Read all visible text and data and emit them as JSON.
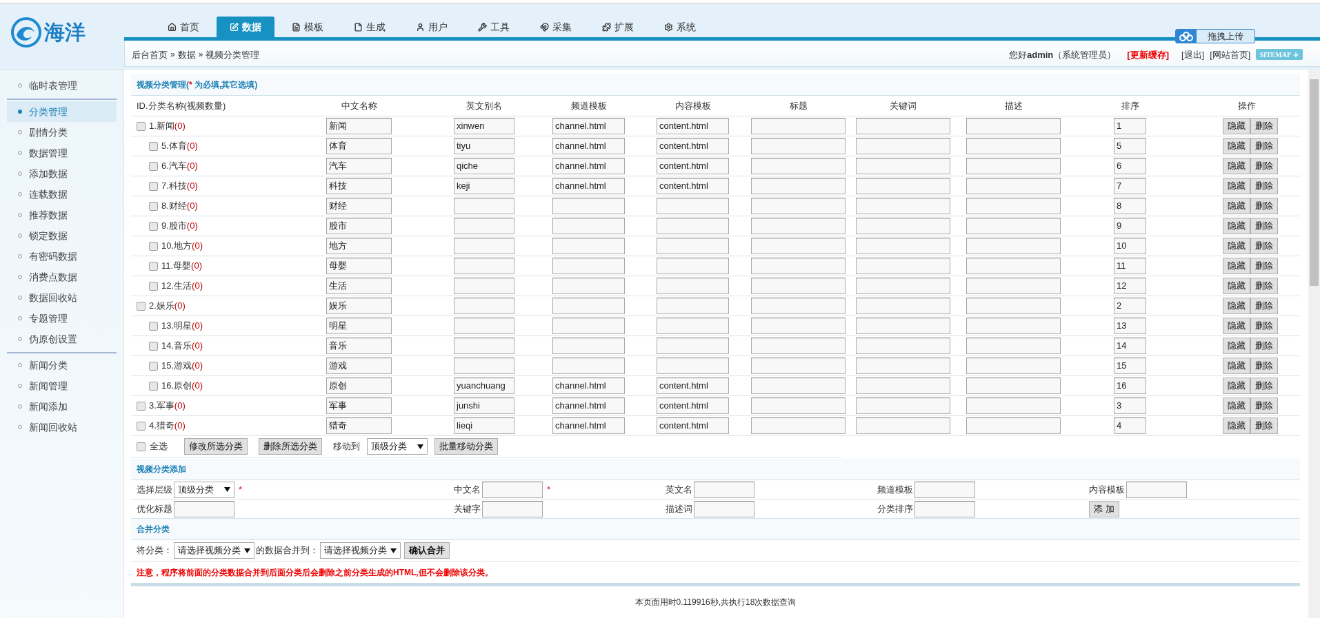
{
  "logo": {
    "text": "海洋"
  },
  "nav": {
    "tabs": [
      {
        "label": "首页",
        "selected": false
      },
      {
        "label": "数据",
        "selected": true
      },
      {
        "label": "模板",
        "selected": false
      },
      {
        "label": "生成",
        "selected": false
      },
      {
        "label": "用户",
        "selected": false
      },
      {
        "label": "工具",
        "selected": false
      },
      {
        "label": "采集",
        "selected": false
      },
      {
        "label": "扩展",
        "selected": false
      },
      {
        "label": "系统",
        "selected": false
      }
    ]
  },
  "upload_button": "拖拽上传",
  "breadcrumb": {
    "items": [
      "后台首页",
      "数据",
      "视频分类管理"
    ],
    "separator": "»"
  },
  "user_bar": {
    "greeting": "您好",
    "user": "admin",
    "role": "（系统管理员）",
    "refresh": "[更新缓存]",
    "logout": "[退出]",
    "site_home": "[网站首页]",
    "sitemap": "SITEMAP"
  },
  "sidebar": {
    "groups": [
      [
        {
          "label": "临时表管理",
          "selected": false
        }
      ],
      [
        {
          "label": "分类管理",
          "selected": true
        },
        {
          "label": "剧情分类",
          "selected": false
        },
        {
          "label": "数据管理",
          "selected": false
        },
        {
          "label": "添加数据",
          "selected": false
        },
        {
          "label": "连载数据",
          "selected": false
        },
        {
          "label": "推荐数据",
          "selected": false
        },
        {
          "label": "锁定数据",
          "selected": false
        },
        {
          "label": "有密码数据",
          "selected": false
        },
        {
          "label": "消费点数据",
          "selected": false
        },
        {
          "label": "数据回收站",
          "selected": false
        },
        {
          "label": "专题管理",
          "selected": false
        },
        {
          "label": "伪原创设置",
          "selected": false
        }
      ],
      [
        {
          "label": "新闻分类",
          "selected": false
        },
        {
          "label": "新闻管理",
          "selected": false
        },
        {
          "label": "新闻添加",
          "selected": false
        },
        {
          "label": "新闻回收站",
          "selected": false
        }
      ]
    ]
  },
  "section_title": {
    "text": "视频分类管理(",
    "required_mark": "*",
    "rest": " 为必填,其它选填)"
  },
  "table": {
    "columns": [
      "ID.分类名称(视频数量)",
      "中文名称",
      "英文别名",
      "频道模板",
      "内容模板",
      "标题",
      "关键词",
      "描述",
      "排序",
      "操作"
    ],
    "rows": [
      {
        "kind": "top",
        "checked": false,
        "label": "1.新闻",
        "count": "(0)",
        "cn": "新闻",
        "en": "xinwen",
        "channel": "channel.html",
        "content": "content.html",
        "sort": "1",
        "actions": [
          "隐藏",
          "删除"
        ]
      },
      {
        "kind": "child",
        "checked": false,
        "label": "5.体育",
        "count": "(0)",
        "cn": "体育",
        "en": "tiyu",
        "channel": "channel.html",
        "content": "content.html",
        "sort": "5",
        "actions": [
          "隐藏",
          "删除"
        ]
      },
      {
        "kind": "child",
        "checked": false,
        "label": "6.汽车",
        "count": "(0)",
        "cn": "汽车",
        "en": "qiche",
        "channel": "channel.html",
        "content": "content.html",
        "sort": "6",
        "actions": [
          "隐藏",
          "删除"
        ]
      },
      {
        "kind": "child",
        "checked": false,
        "label": "7.科技",
        "count": "(0)",
        "cn": "科技",
        "en": "keji",
        "channel": "channel.html",
        "content": "content.html",
        "sort": "7",
        "actions": [
          "隐藏",
          "删除"
        ]
      },
      {
        "kind": "child",
        "checked": false,
        "label": "8.财经",
        "count": "(0)",
        "cn": "财经",
        "sort": "8",
        "actions": [
          "隐藏",
          "删除"
        ]
      },
      {
        "kind": "child",
        "checked": false,
        "label": "9.股市",
        "count": "(0)",
        "cn": "股市",
        "sort": "9",
        "actions": [
          "隐藏",
          "删除"
        ]
      },
      {
        "kind": "child",
        "checked": false,
        "label": "10.地方",
        "count": "(0)",
        "cn": "地方",
        "sort": "10",
        "actions": [
          "隐藏",
          "删除"
        ]
      },
      {
        "kind": "child",
        "checked": false,
        "label": "11.母婴",
        "count": "(0)",
        "cn": "母婴",
        "sort": "11",
        "actions": [
          "隐藏",
          "删除"
        ]
      },
      {
        "kind": "child",
        "checked": false,
        "label": "12.生活",
        "count": "(0)",
        "cn": "生活",
        "sort": "12",
        "actions": [
          "隐藏",
          "删除"
        ]
      },
      {
        "kind": "top",
        "checked": false,
        "label": "2.娱乐",
        "count": "(0)",
        "cn": "娱乐",
        "sort": "2",
        "actions": [
          "隐藏",
          "删除"
        ]
      },
      {
        "kind": "child",
        "checked": false,
        "label": "13.明星",
        "count": "(0)",
        "cn": "明星",
        "sort": "13",
        "actions": [
          "隐藏",
          "删除"
        ]
      },
      {
        "kind": "child",
        "checked": false,
        "label": "14.音乐",
        "count": "(0)",
        "cn": "音乐",
        "sort": "14",
        "actions": [
          "隐藏",
          "删除"
        ]
      },
      {
        "kind": "child",
        "checked": false,
        "label": "15.游戏",
        "count": "(0)",
        "cn": "游戏",
        "sort": "15",
        "actions": [
          "隐藏",
          "删除"
        ]
      },
      {
        "kind": "child",
        "checked": false,
        "label": "16.原创",
        "count": "(0)",
        "cn": "原创",
        "en": "yuanchuang",
        "channel": "channel.html",
        "content": "content.html",
        "sort": "16",
        "actions": [
          "隐藏",
          "删除"
        ]
      },
      {
        "kind": "top",
        "checked": false,
        "label": "3.军事",
        "count": "(0)",
        "cn": "军事",
        "en": "junshi",
        "channel": "channel.html",
        "content": "content.html",
        "sort": "3",
        "actions": [
          "隐藏",
          "删除"
        ]
      },
      {
        "kind": "top",
        "checked": false,
        "label": "4.猎奇",
        "count": "(0)",
        "cn": "猎奇",
        "en": "lieqi",
        "channel": "channel.html",
        "content": "content.html",
        "sort": "4",
        "actions": [
          "隐藏",
          "删除"
        ]
      }
    ]
  },
  "bulk": {
    "select_all": {
      "label": "全选",
      "checked": false
    },
    "buttons": [
      "修改所选分类",
      "删除所选分类"
    ],
    "move_label": "移动到",
    "move_select": "顶级分类",
    "move_button": "批量移动分类"
  },
  "add_form": {
    "title": "视频分类添加",
    "rows": [
      [
        {
          "kind": "select",
          "label": "选择层级",
          "value": "顶级分类",
          "required": true
        },
        {
          "kind": "input",
          "label": "中文名",
          "required": true
        },
        {
          "kind": "input",
          "label": "英文名",
          "required": false
        },
        {
          "kind": "input",
          "label": "频道模板",
          "required": false
        },
        {
          "kind": "input",
          "label": "内容模板",
          "required": false
        }
      ],
      [
        {
          "kind": "input",
          "label": "优化标题",
          "required": false
        },
        {
          "kind": "input",
          "label": "关键字",
          "required": false
        },
        {
          "kind": "input",
          "label": "描述词",
          "required": false
        },
        {
          "kind": "input",
          "label": "分类排序",
          "required": false
        },
        {
          "kind": "button",
          "label": "添 加"
        }
      ]
    ],
    "required_mark": "*"
  },
  "merge": {
    "title": "合并分类",
    "from_label": "将分类：",
    "from_select": "请选择视频分类",
    "to_label": "的数据合并到：",
    "to_select": "请选择视频分类",
    "button": "确认合并"
  },
  "note": "注意，程序将前面的分类数据合并到后面分类后会删除之前分类生成的HTML,但不会删除该分类。",
  "footer": "本页面用时0.119916秒,共执行18次数据查询"
}
